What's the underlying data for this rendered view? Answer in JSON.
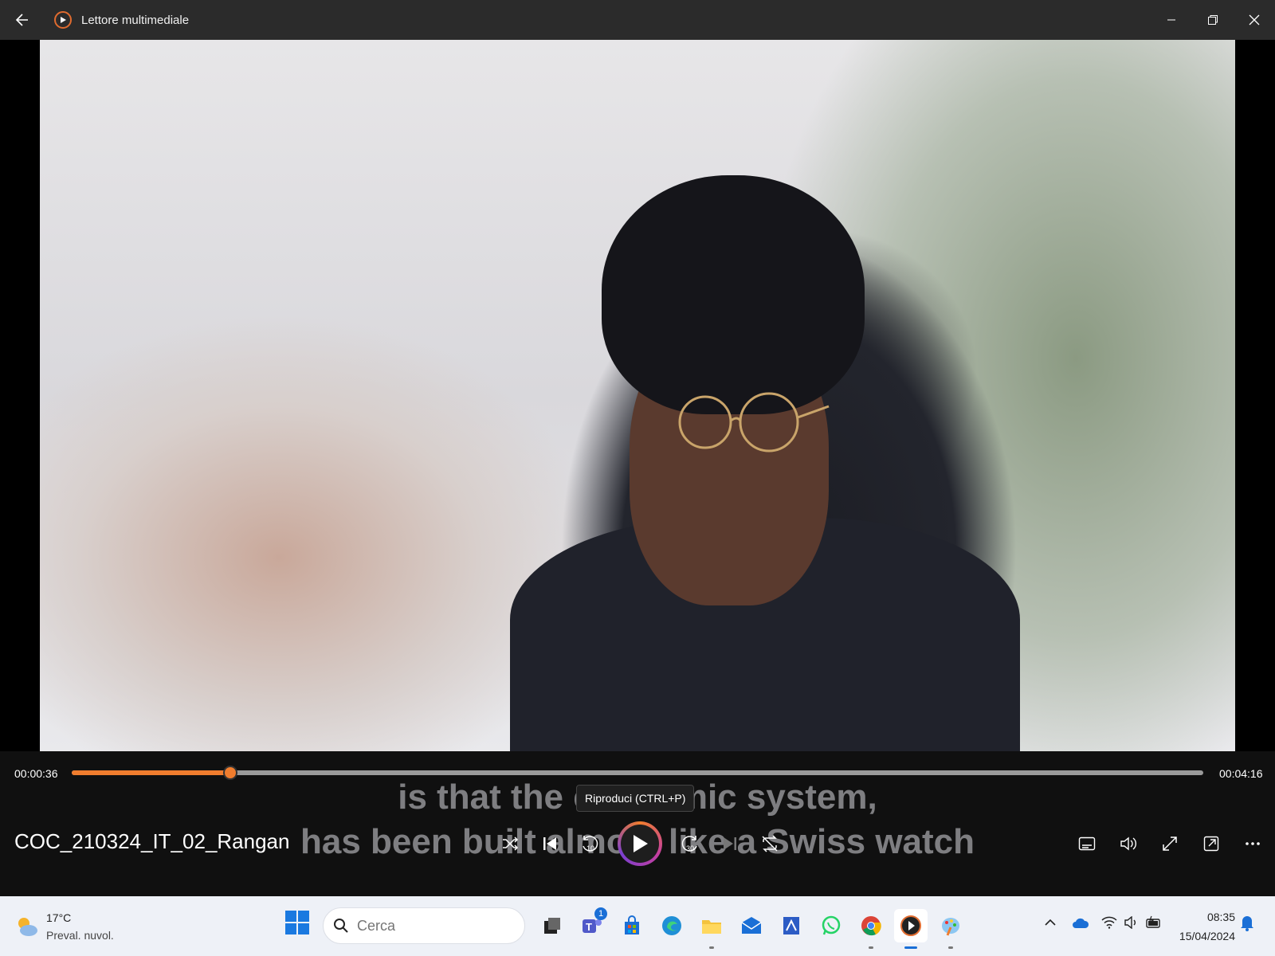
{
  "window": {
    "title": "Lettore multimediale"
  },
  "player": {
    "current_time": "00:00:36",
    "total_time": "00:04:16",
    "progress_fraction": 0.14,
    "media_title": "COC_210324_IT_02_Rangan",
    "subtitle_line1": "is that the economic system,",
    "subtitle_line2": "has been built almost like a Swiss watch",
    "tooltip": "Riproduci (CTRL+P)",
    "accent_color": "#f07d2e",
    "buttons": {
      "shuffle": "shuffle-icon",
      "previous": "previous-icon",
      "skip_back": "10",
      "play": "play-icon",
      "skip_forward": "30",
      "next": "next-icon",
      "repeat": "repeat-off-icon",
      "subtitles": "subtitles-icon",
      "volume": "volume-icon",
      "fullscreen": "fullscreen-icon",
      "miniplayer": "miniplayer-icon",
      "more": "more-icon"
    }
  },
  "taskbar": {
    "weather_temp": "17°C",
    "weather_desc": "Preval. nuvol.",
    "search_placeholder": "Cerca",
    "teams_badge": "1",
    "clock_time": "08:35",
    "clock_date": "15/04/2024"
  }
}
